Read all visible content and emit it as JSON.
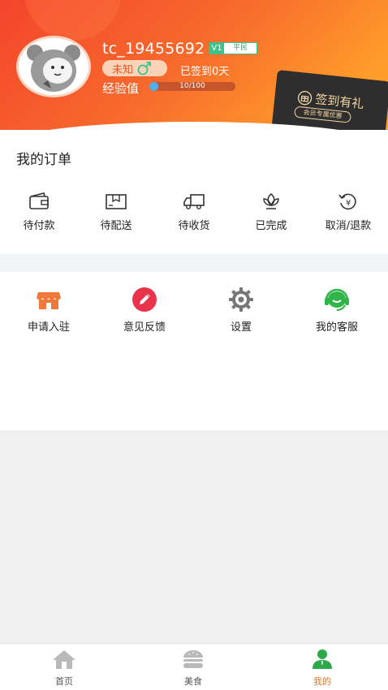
{
  "profile": {
    "username": "tc_19455692",
    "vip_level": "V1",
    "vip_title": "平民",
    "gender_text": "未知",
    "checkin_days": "已签到0天",
    "exp_label": "经验值",
    "exp_text": "10/100",
    "exp_fraction": 0.1
  },
  "checkin_card": {
    "title": "签到有礼",
    "subtitle": "会员专属优惠"
  },
  "orders": {
    "title": "我的订单",
    "items": [
      {
        "label": "待付款",
        "icon": "wallet-icon"
      },
      {
        "label": "待配送",
        "icon": "package-icon"
      },
      {
        "label": "待收货",
        "icon": "truck-icon"
      },
      {
        "label": "已完成",
        "icon": "lotus-icon"
      },
      {
        "label": "取消/退款",
        "icon": "refund-icon"
      }
    ]
  },
  "tools": {
    "items": [
      {
        "label": "申请入驻",
        "icon": "shop-icon"
      },
      {
        "label": "意见反馈",
        "icon": "pencil-icon"
      },
      {
        "label": "设置",
        "icon": "gear-icon"
      },
      {
        "label": "我的客服",
        "icon": "headset-icon"
      }
    ]
  },
  "bottom_nav": {
    "items": [
      {
        "label": "首页",
        "icon": "home-icon",
        "active": false
      },
      {
        "label": "美食",
        "icon": "burger-icon",
        "active": false
      },
      {
        "label": "我的",
        "icon": "user-icon",
        "active": true
      }
    ]
  },
  "colors": {
    "header_orange": "#f4512c",
    "header_light": "#ff9a2a",
    "accent_active": "#e2762a",
    "vip_green": "#3cc28a",
    "exp_blue": "#4db0ef"
  }
}
